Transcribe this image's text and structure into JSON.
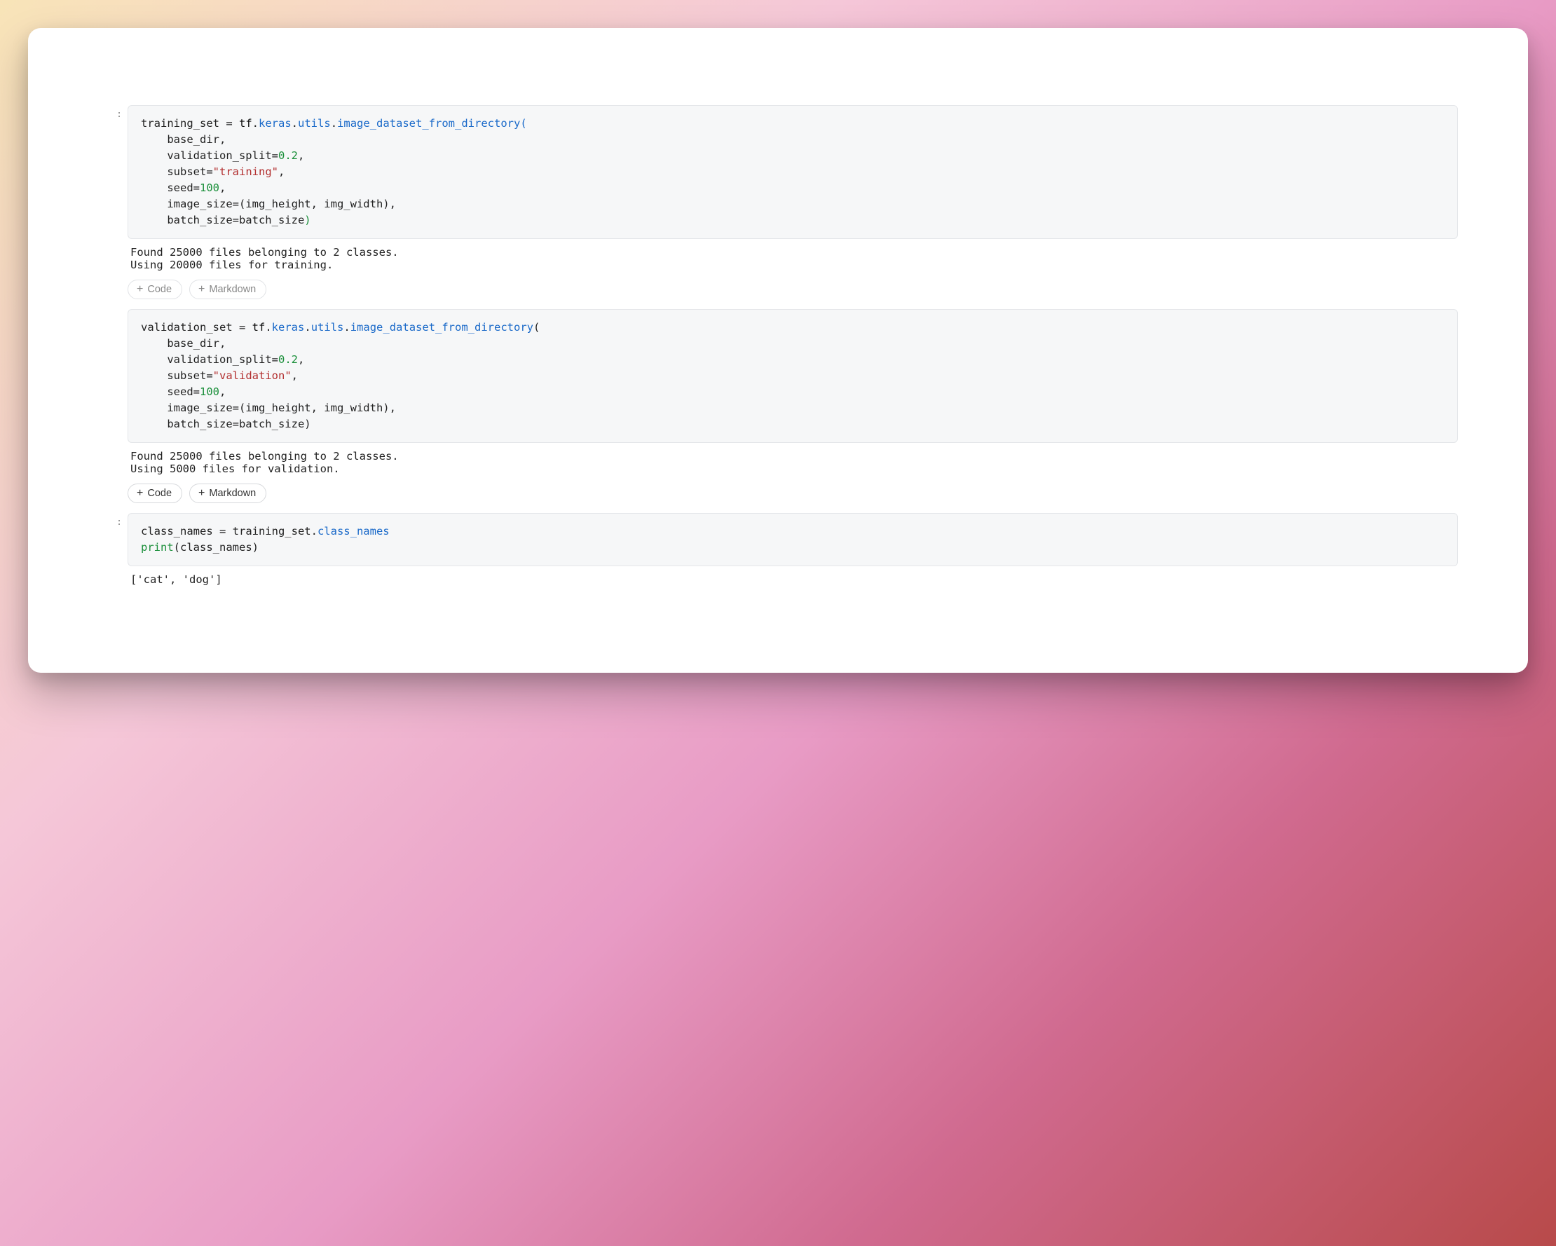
{
  "gutter_marker": ":",
  "buttons": {
    "code": "Code",
    "markdown": "Markdown"
  },
  "cell1": {
    "code": {
      "lhs": "training_set",
      "eq": " = ",
      "tf": "tf",
      "dot1": ".",
      "keras": "keras",
      "dot2": ".",
      "utils": "utils",
      "dot3": ".",
      "fn": "image_dataset_from_directory",
      "lp": "(",
      "line2": "    base_dir,",
      "line3a": "    validation_split",
      "line3b": "=",
      "line3c": "0.2",
      "line3d": ",",
      "line4a": "    subset",
      "line4b": "=",
      "line4c": "\"training\"",
      "line4d": ",",
      "line5a": "    seed",
      "line5b": "=",
      "line5c": "100",
      "line5d": ",",
      "line6": "    image_size=(img_height, img_width),",
      "line7a": "    batch_size=batch_size",
      "rp": ")"
    },
    "output": "Found 25000 files belonging to 2 classes.\nUsing 20000 files for training."
  },
  "cell2": {
    "code": {
      "lhs": "validation_set",
      "eq": " = ",
      "tf": "tf",
      "dot1": ".",
      "keras": "keras",
      "dot2": ".",
      "utils": "utils",
      "dot3": ".",
      "fn": "image_dataset_from_directory",
      "lp": "(",
      "line2": "    base_dir,",
      "line3a": "    validation_split",
      "line3b": "=",
      "line3c": "0.2",
      "line3d": ",",
      "line4a": "    subset",
      "line4b": "=",
      "line4c": "\"validation\"",
      "line4d": ",",
      "line5a": "    seed",
      "line5b": "=",
      "line5c": "100",
      "line5d": ",",
      "line6": "    image_size=(img_height, img_width),",
      "line7a": "    batch_size=batch_size)"
    },
    "output": "Found 25000 files belonging to 2 classes.\nUsing 5000 files for validation."
  },
  "cell3": {
    "code": {
      "line1a": "class_names",
      "line1b": " = training_set.",
      "line1c": "class_names",
      "line2a": "print",
      "line2b": "(class_names)"
    },
    "output": "['cat', 'dog']"
  }
}
